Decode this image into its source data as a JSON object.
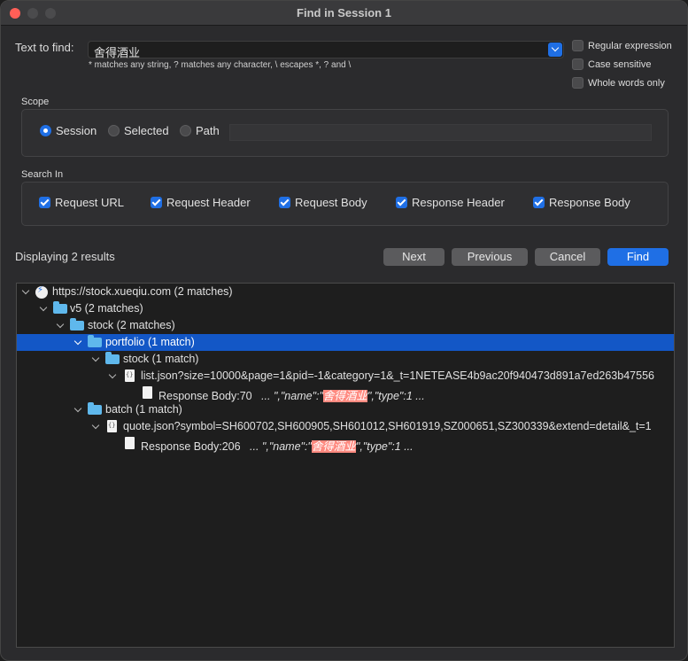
{
  "window": {
    "title": "Find in Session 1"
  },
  "find": {
    "label": "Text to find:",
    "value": "舍得酒业",
    "hint": "* matches any string, ? matches any character, \\ escapes *, ? and \\"
  },
  "options": {
    "regex": "Regular expression",
    "case": "Case sensitive",
    "whole": "Whole words only"
  },
  "scope": {
    "title": "Scope",
    "session": "Session",
    "selected": "Selected",
    "path": "Path"
  },
  "search_in": {
    "title": "Search In",
    "request_url": "Request URL",
    "request_header": "Request Header",
    "request_body": "Request Body",
    "response_header": "Response Header",
    "response_body": "Response Body"
  },
  "results": {
    "status": "Displaying 2 results"
  },
  "buttons": {
    "next": "Next",
    "previous": "Previous",
    "cancel": "Cancel",
    "find": "Find"
  },
  "tree": {
    "host": "https://stock.xueqiu.com (2 matches)",
    "v5": "v5 (2 matches)",
    "stock": "stock (2 matches)",
    "portfolio": "portfolio (1 match)",
    "stock_inner": "stock (1 match)",
    "list_file": "list.json?size=10000&page=1&pid=-1&category=1&_t=1NETEASE4b9ac20f940473d891a7ed263b47556",
    "match1": {
      "prefix": "Response Body:70",
      "before": "... \",\"name\":\"",
      "highlight": "舍得酒业",
      "after": "\",\"type\":1 ..."
    },
    "batch": "batch (1 match)",
    "quote_file": "quote.json?symbol=SH600702,SH600905,SH601012,SH601919,SZ000651,SZ300339&extend=detail&_t=1",
    "match2": {
      "prefix": "Response Body:206",
      "before": "... \",\"name\":\"",
      "highlight": "舍得酒业",
      "after": "\",\"type\":1 ..."
    }
  }
}
